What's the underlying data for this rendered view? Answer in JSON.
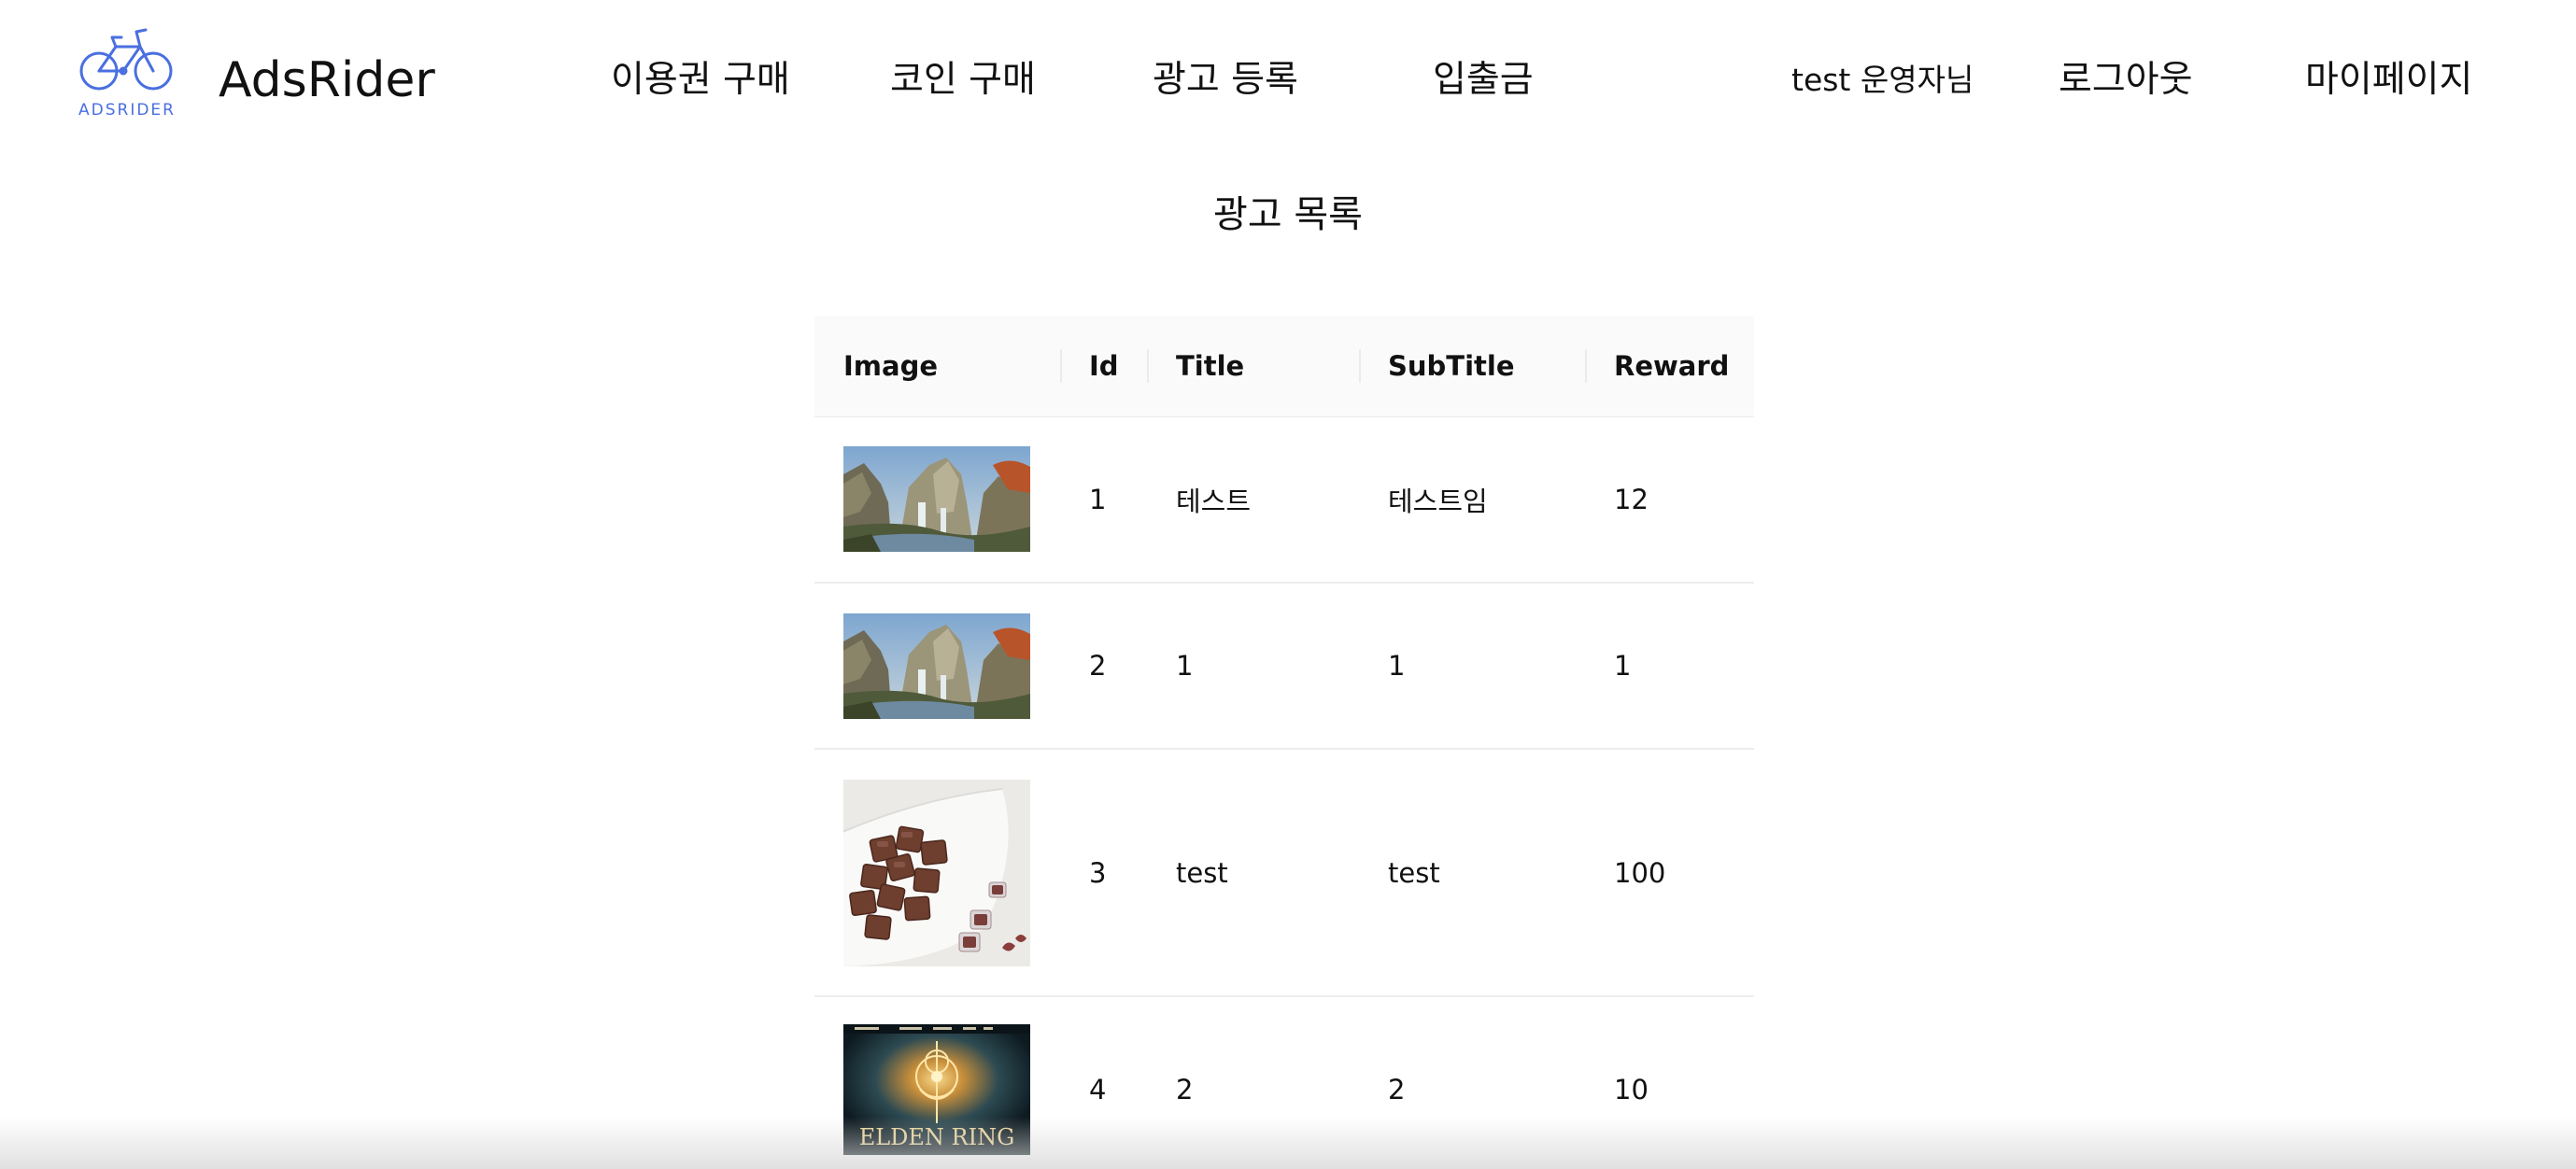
{
  "header": {
    "logo_text": "ADSRIDER",
    "brand": "AdsRider",
    "nav": {
      "buy_pass": "이용권 구매",
      "buy_coin": "코인 구매",
      "register_ad": "광고 등록",
      "deposit_withdraw": "입출금"
    },
    "user_greeting": "test 운영자님",
    "logout": "로그아웃",
    "mypage": "마이페이지"
  },
  "page_title": "광고 목록",
  "table": {
    "columns": [
      "Image",
      "Id",
      "Title",
      "SubTitle",
      "Reward"
    ],
    "rows": [
      {
        "image": "waterfall-landscape-thumbnail",
        "id": "1",
        "title": "테스트",
        "subtitle": "테스트임",
        "reward": "12"
      },
      {
        "image": "waterfall-landscape-thumbnail",
        "id": "2",
        "title": "1",
        "subtitle": "1",
        "reward": "1"
      },
      {
        "image": "chocolate-candies-thumbnail",
        "id": "3",
        "title": "test",
        "subtitle": "test",
        "reward": "100"
      },
      {
        "image": "elden-ring-thumbnail",
        "id": "4",
        "title": "2",
        "subtitle": "2",
        "reward": "10",
        "image_text": "ELDEN RING"
      }
    ]
  },
  "colors": {
    "logo_accent": "#4a6fe0",
    "header_bg": "#fafafa",
    "row_border": "#ededed"
  }
}
